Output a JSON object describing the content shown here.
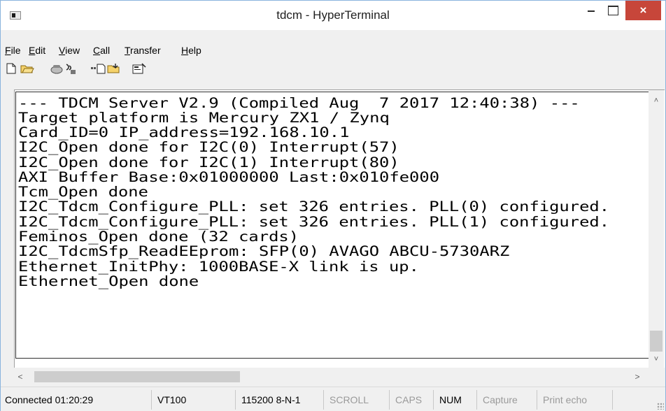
{
  "window": {
    "title": "tdcm - HyperTerminal",
    "close_glyph": "×"
  },
  "menu": {
    "items": [
      {
        "key": "F",
        "rest": "ile"
      },
      {
        "key": "E",
        "rest": "dit"
      },
      {
        "key": "V",
        "rest": "iew"
      },
      {
        "key": "C",
        "rest": "all"
      },
      {
        "key": "T",
        "rest": "ransfer"
      },
      {
        "key": "H",
        "rest": "elp"
      }
    ]
  },
  "toolbar": {
    "icons": [
      "new-document-icon",
      "open-folder-icon",
      "phone-call-icon",
      "disconnect-icon",
      "send-file-icon",
      "receive-file-icon",
      "properties-icon"
    ]
  },
  "terminal": {
    "lines": [
      "--- TDCM Server V2.9 (Compiled Aug  7 2017 12:40:38) ---",
      "Target platform is Mercury ZX1 / Zynq",
      "Card_ID=0 IP_address=192.168.10.1",
      "I2C_Open done for I2C(0) Interrupt(57)",
      "I2C_Open done for I2C(1) Interrupt(80)",
      "AXI Buffer Base:0x01000000 Last:0x010fe000",
      "Tcm_Open done",
      "I2C_Tdcm_Configure_PLL: set 326 entries. PLL(0) configured.",
      "I2C_Tdcm_Configure_PLL: set 326 entries. PLL(1) configured.",
      "Feminos_Open done (32 cards)",
      "I2C_TdcmSfp_ReadEEprom: SFP(0) AVAGO ABCU-5730ARZ",
      "Ethernet_InitPhy: 1000BASE-X link is up.",
      "Ethernet_Open done"
    ]
  },
  "scroll": {
    "vertical_position": 0.92,
    "horizontal_position": 0.0
  },
  "status": {
    "connection": "Connected 01:20:29",
    "emulation": "VT100",
    "port_settings": "115200 8-N-1",
    "scroll": "SCROLL",
    "caps": "CAPS",
    "num": "NUM",
    "capture": "Capture",
    "print_echo": "Print echo"
  }
}
